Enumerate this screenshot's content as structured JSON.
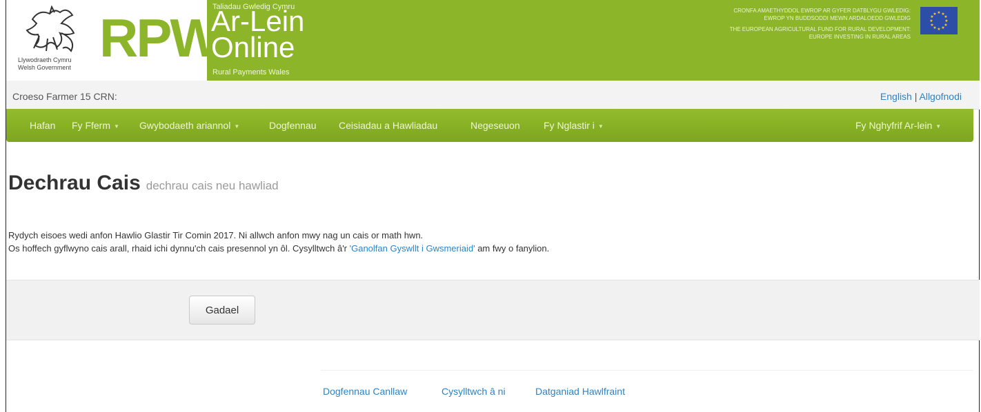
{
  "header": {
    "gov_name_line1": "Llywodraeth Cymru",
    "gov_name_line2": "Welsh Government",
    "logo_text": "RPW",
    "tagline_welsh_small": "Taliadau Gwledig Cymru",
    "title_welsh": "Ar-Lein",
    "title_english": "Online",
    "subtitle": "Rural Payments Wales",
    "eu_text_welsh": "Cronfa Amaethyddol Ewrop ar gyfer Datblygu Gwledig: Ewrop yn buddsoddi mewn ardaloedd gwledig",
    "eu_text_english": "The European Agricultural Fund for Rural Development: Europe investing in rural areas",
    "brand_green": "#8cb529",
    "eu_blue": "#2d4ea7"
  },
  "userbar": {
    "welcome": "Croeso Farmer 15 CRN:",
    "english_link": "English",
    "separator": "|",
    "logout_link": "Allgofnodi"
  },
  "nav": {
    "items": [
      {
        "label": "Hafan",
        "dropdown": false
      },
      {
        "label": "Fy Fferm",
        "dropdown": true
      },
      {
        "label": "Gwybodaeth ariannol",
        "dropdown": true
      },
      {
        "label": "Dogfennau",
        "dropdown": false
      },
      {
        "label": "Ceisiadau a Hawliadau",
        "dropdown": false
      },
      {
        "label": "Negeseuon",
        "dropdown": false
      },
      {
        "label": "Fy Nglastir i",
        "dropdown": true
      }
    ],
    "account_menu": {
      "label": "Fy Nghyfrif Ar-lein",
      "dropdown": true
    }
  },
  "main": {
    "title": "Dechrau Cais",
    "subtitle": "dechrau cais neu hawliad",
    "message_line1": "Rydych eisoes wedi anfon Hawlio Glastir Tir Comin 2017. Ni allwch anfon mwy nag un cais or math hwn.",
    "message_line2_before": "Os hoffech gyflwyno cais arall, rhaid ichi dynnu'ch cais presennol yn ôl. Cysylltwch â'r ",
    "message_line2_link": "'Ganolfan Gyswllt i Gwsmeriaid'",
    "message_line2_after": " am fwy o fanylion.",
    "leave_button": "Gadael"
  },
  "footer": {
    "links": [
      "Dogfennau Canllaw",
      "Cysylltwch â ni",
      "Datganiad Hawlfraint"
    ],
    "link_color": "#2c83c6"
  }
}
